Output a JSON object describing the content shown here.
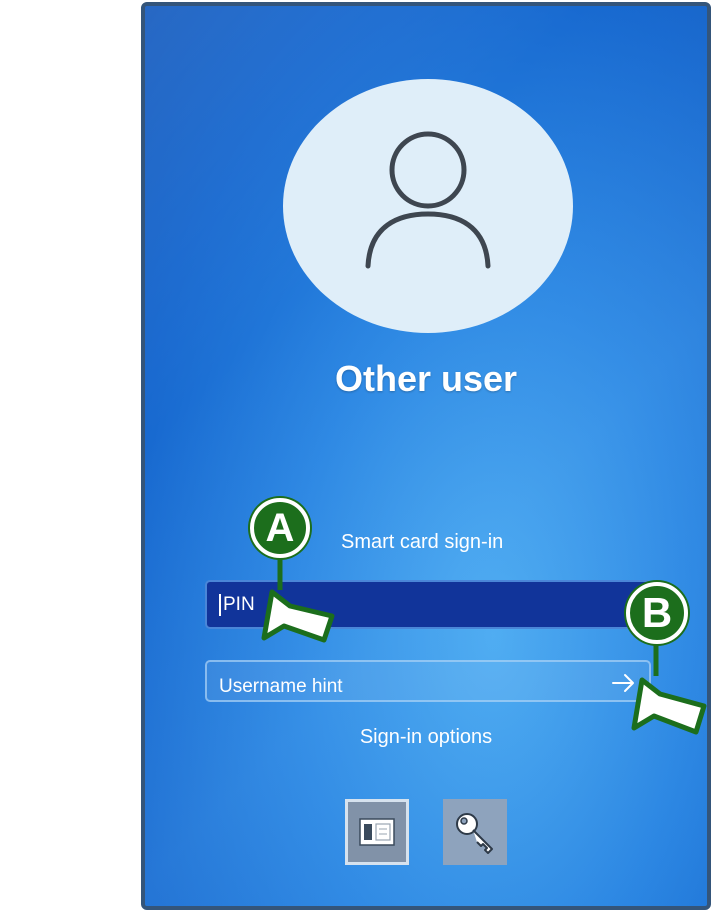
{
  "login_screen": {
    "user_name": "Other user",
    "smart_card_link": "Smart card sign-in",
    "pin_placeholder": "PIN",
    "username_hint_placeholder": "Username hint",
    "sign_in_options_label": "Sign-in options",
    "sign_in_options": [
      {
        "icon": "smart-card-icon",
        "selected": true
      },
      {
        "icon": "key-icon",
        "selected": false
      }
    ]
  },
  "annotations": [
    {
      "label": "A",
      "target": "pin-field",
      "color": "#1c6e1c"
    },
    {
      "label": "B",
      "target": "submit-arrow-button",
      "color": "#1c6e1c"
    }
  ]
}
